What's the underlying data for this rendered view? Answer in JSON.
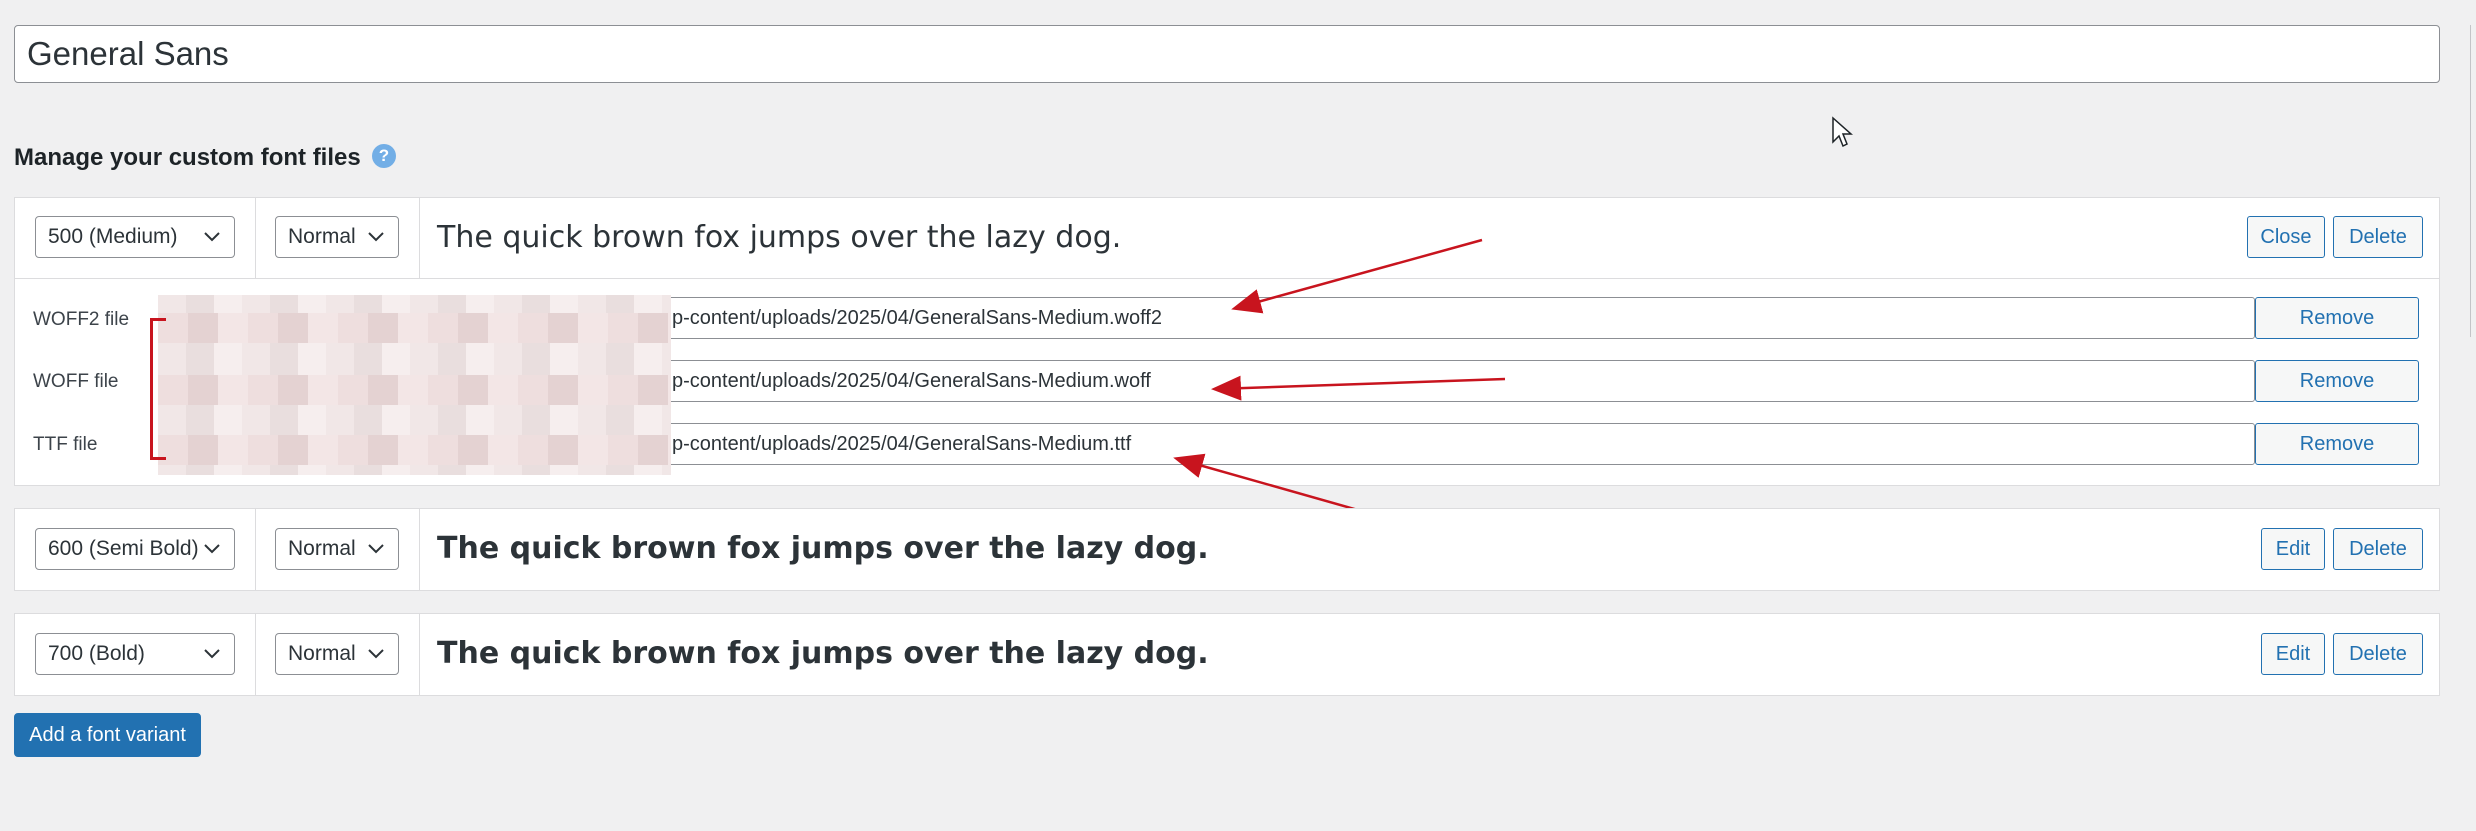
{
  "font": {
    "name_value": "General Sans"
  },
  "section": {
    "heading": "Manage your custom font files",
    "help_icon": "question-circle-icon"
  },
  "variants": [
    {
      "weight": "500 (Medium)",
      "style": "Normal",
      "preview": "The quick brown fox jumps over the lazy dog.",
      "buttons": {
        "primary": "Close",
        "delete": "Delete"
      },
      "expanded": true,
      "files": [
        {
          "label": "WOFF2 file",
          "value": "p-content/uploads/2025/04/GeneralSans-Medium.woff2",
          "remove": "Remove"
        },
        {
          "label": "WOFF file",
          "value": "p-content/uploads/2025/04/GeneralSans-Medium.woff",
          "remove": "Remove"
        },
        {
          "label": "TTF file",
          "value": "p-content/uploads/2025/04/GeneralSans-Medium.ttf",
          "remove": "Remove"
        }
      ]
    },
    {
      "weight": "600 (Semi Bold)",
      "style": "Normal",
      "preview": "The quick brown fox jumps over the lazy dog.",
      "buttons": {
        "primary": "Edit",
        "delete": "Delete"
      }
    },
    {
      "weight": "700 (Bold)",
      "style": "Normal",
      "preview": "The quick brown fox jumps over the lazy dog.",
      "buttons": {
        "primary": "Edit",
        "delete": "Delete"
      }
    }
  ],
  "add_button": "Add a font variant",
  "colors": {
    "accent": "#2271b1",
    "annotation": "#c8141e",
    "help": "#72aee6"
  }
}
